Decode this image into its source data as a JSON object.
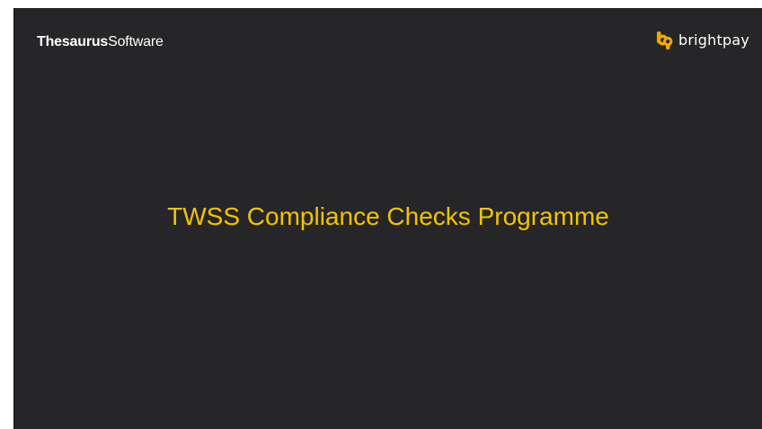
{
  "header": {
    "company_bold": "Thesaurus",
    "company_light": "Software",
    "product_logo_text": "brightpay",
    "product_logo_icon": "bp-logo-icon"
  },
  "slide": {
    "title": "TWSS Compliance Checks Programme"
  },
  "colors": {
    "slide_background": "#262628",
    "title_text": "#f2c400",
    "brand_text": "#ffffff",
    "logo_accent": "#f5a800",
    "page_background": "#ffffff"
  }
}
